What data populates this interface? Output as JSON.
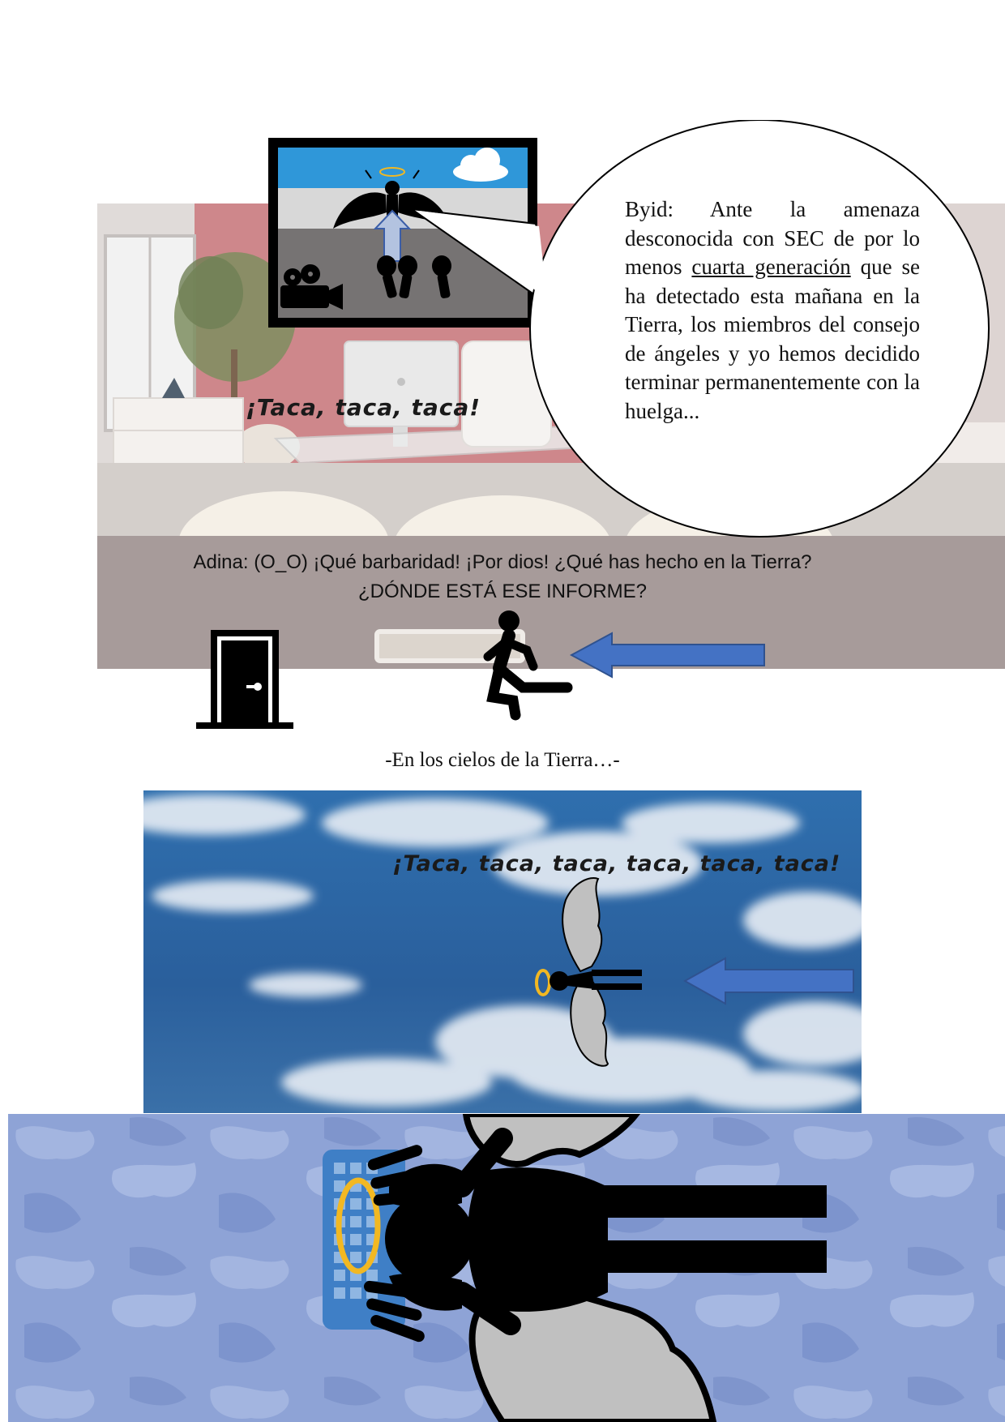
{
  "office_panel": {
    "sfx": "¡Taca, taca, taca!",
    "speech": {
      "speaker": "Byid:",
      "text_before": "Ante la amenaza desconocida con SEC de por lo menos",
      "underlined": "cuarta generación",
      "text_after": "que se ha detectado esta mañana en la Tierra, los miembros del consejo de ángeles y yo hemos decidido terminar permanentemente con la huelga..."
    },
    "dialogue_line1": "Adina: (O_O) ¡Qué barbaridad! ¡Por dios! ¿Qué has hecho en la Tierra?",
    "dialogue_line2": "¿DÓNDE ESTÁ ESE INFORME?"
  },
  "caption": "-En los cielos de la Tierra…-",
  "sky_panel": {
    "sfx": "¡Taca, taca, taca, taca, taca, taca!"
  },
  "colors": {
    "arrow": "#4472C4",
    "halo": "#F2B822",
    "sky_top": "#2F97D9",
    "office_wall": "#C9646A",
    "pattern_bg": "#8EA3D6"
  }
}
